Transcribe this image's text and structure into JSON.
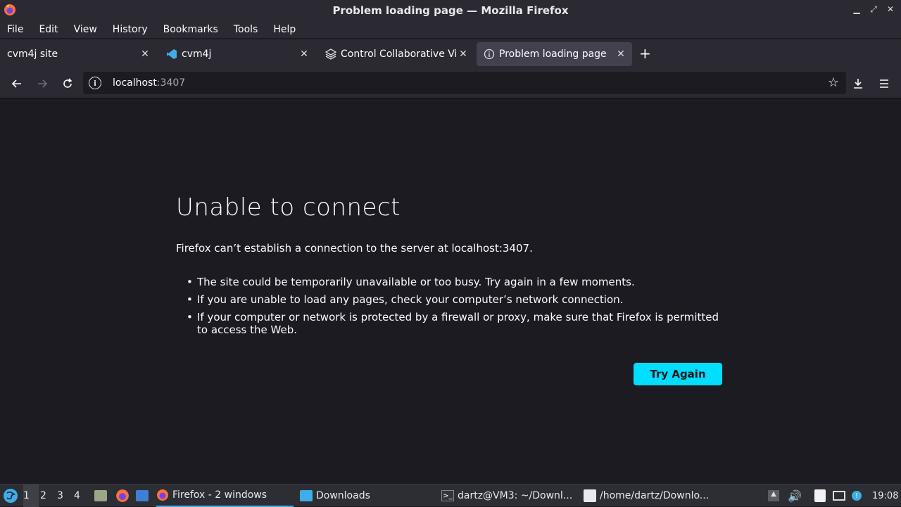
{
  "window": {
    "title": "Problem loading page — Mozilla Firefox"
  },
  "menu": [
    "File",
    "Edit",
    "View",
    "History",
    "Bookmarks",
    "Tools",
    "Help"
  ],
  "tabs": [
    {
      "label": "cvm4j site",
      "icon": "none",
      "active": false
    },
    {
      "label": "cvm4j",
      "icon": "vscode-icon",
      "active": false
    },
    {
      "label": "Control Collaborative Virt",
      "icon": "layers-icon",
      "active": false
    },
    {
      "label": "Problem loading page",
      "icon": "info-icon",
      "active": true
    }
  ],
  "urlbar": {
    "host": "localhost",
    "port": ":3407"
  },
  "error": {
    "title": "Unable to connect",
    "description": "Firefox can’t establish a connection to the server at localhost:3407.",
    "bullets": [
      "The site could be temporarily unavailable or too busy. Try again in a few moments.",
      "If you are unable to load any pages, check your computer’s network connection.",
      "If your computer or network is protected by a firewall or proxy, make sure that Firefox is permitted to access the Web."
    ],
    "button": "Try Again"
  },
  "taskbar": {
    "workspaces": [
      "1",
      "2",
      "3",
      "4"
    ],
    "tasks": [
      {
        "label": "Firefox - 2 windows",
        "icon": "firefox-icon"
      },
      {
        "label": "Downloads",
        "icon": "folder-icon"
      },
      {
        "label": "dartz@VM3: ~/Downl...",
        "icon": "terminal-icon"
      },
      {
        "label": "/home/dartz/Downlo...",
        "icon": "text-editor-icon"
      }
    ],
    "clock": "19:08"
  },
  "colors": {
    "accent": "#00ddff",
    "background": "#1c1b22",
    "chrome": "#2b2a33"
  }
}
